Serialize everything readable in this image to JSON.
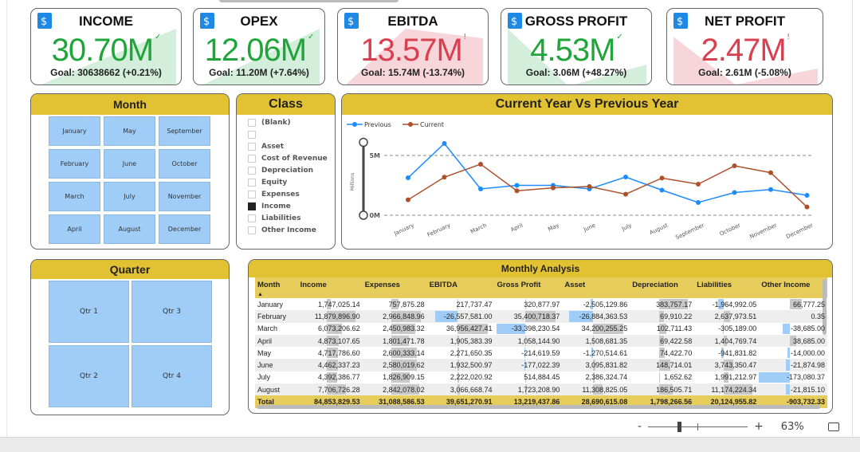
{
  "kpis": [
    {
      "title": "INCOME",
      "value": "30.70M",
      "goal": "Goal: 30638662 (+0.21%)",
      "status": "good",
      "icon": "invoice-dollar-icon"
    },
    {
      "title": "OPEX",
      "value": "12.06M",
      "goal": "Goal: 11.20M (+7.64%)",
      "status": "good",
      "icon": "card-payment-icon"
    },
    {
      "title": "EBITDA",
      "value": "13.57M",
      "goal": "Goal: 15.74M (-13.74%)",
      "status": "bad",
      "icon": "dollar-down-arrow-icon"
    },
    {
      "title": "GROSS PROFIT",
      "value": "4.53M",
      "goal": "Goal: 3.06M (+48.27%)",
      "status": "good",
      "icon": "money-bag-icon"
    },
    {
      "title": "NET PROFIT",
      "value": "2.47M",
      "goal": "Goal: 2.61M (-5.08%)",
      "status": "bad",
      "icon": "money-bag-icon"
    }
  ],
  "colors": {
    "good": "#1FA53A",
    "bad": "#D9404F",
    "good_bg": "#D3EEDA",
    "bad_bg": "#F6D6DA",
    "header": "#E2C132",
    "slicer": "#A0CDF7",
    "previous": "#1A8CFF",
    "current": "#B0502A"
  },
  "month_slicer": {
    "title": "Month",
    "items": [
      "January",
      "May",
      "September",
      "February",
      "June",
      "October",
      "March",
      "July",
      "November",
      "April",
      "August",
      "December"
    ]
  },
  "class_slicer": {
    "title": "Class",
    "items": [
      {
        "label": "(Blank)",
        "checked": false
      },
      {
        "label": "",
        "checked": false
      },
      {
        "label": "Asset",
        "checked": false
      },
      {
        "label": "Cost of Revenue",
        "checked": false
      },
      {
        "label": "Depreciation",
        "checked": false
      },
      {
        "label": "Equity",
        "checked": false
      },
      {
        "label": "Expenses",
        "checked": false
      },
      {
        "label": "Income",
        "checked": true
      },
      {
        "label": "Liabilities",
        "checked": false
      },
      {
        "label": "Other Income",
        "checked": false
      }
    ]
  },
  "quarter_slicer": {
    "title": "Quarter",
    "items": [
      "Qtr 1",
      "Qtr 3",
      "Qtr 2",
      "Qtr 4"
    ]
  },
  "chart_data": {
    "type": "line",
    "title": "Current Year Vs Previous Year",
    "ylabel": "Millions",
    "xlabel": "",
    "categories": [
      "January",
      "February",
      "March",
      "April",
      "May",
      "June",
      "July",
      "August",
      "September",
      "October",
      "November",
      "December"
    ],
    "series": [
      {
        "name": "Previous",
        "values": [
          3.13,
          6.0,
          2.2,
          2.5,
          2.5,
          2.2,
          3.2,
          2.1,
          1.07,
          1.9,
          2.15,
          1.67
        ]
      },
      {
        "name": "Current",
        "values": [
          1.29,
          3.18,
          4.27,
          2.04,
          2.29,
          2.4,
          1.76,
          3.11,
          2.6,
          4.13,
          3.56,
          0.69
        ]
      }
    ],
    "yticks": [
      "0M",
      "5M"
    ],
    "ylim": [
      0,
      6.5
    ],
    "grid": true,
    "legend": "top-left"
  },
  "table": {
    "title": "Monthly Analysis",
    "columns": [
      "Month",
      "Income",
      "Expenses",
      "EBITDA",
      "Gross Profit",
      "Asset",
      "Depreciation",
      "Liabilities",
      "Other Income"
    ],
    "rows": [
      [
        "January",
        "1,747,025.14",
        "757,875.28",
        "217,737.47",
        "320,877.97",
        "-2,505,129.86",
        "383,757.17",
        "-1,964,992.05",
        "66,777.25"
      ],
      [
        "February",
        "11,879,896.90",
        "2,966,848.96",
        "-26,557,581.00",
        "35,400,718.37",
        "-26,884,363.53",
        "69,910.22",
        "2,637,973.51",
        "0.35"
      ],
      [
        "March",
        "6,073,206.62",
        "2,450,983.32",
        "36,956,427.41",
        "-33,398,230.54",
        "34,200,255.25",
        "102,711.43",
        "-305,189.00",
        "-38,685.00"
      ],
      [
        "April",
        "4,873,107.65",
        "1,801,471.78",
        "1,905,383.39",
        "1,058,144.90",
        "1,508,681.35",
        "69,422.58",
        "1,404,769.74",
        "38,685.00"
      ],
      [
        "May",
        "4,717,786.60",
        "2,600,333.14",
        "2,271,650.35",
        "-214,619.59",
        "-1,270,514.61",
        "74,422.70",
        "-941,831.82",
        "-14,000.00"
      ],
      [
        "June",
        "4,462,337.23",
        "2,580,019.62",
        "1,932,500.97",
        "-177,022.39",
        "3,095,831.82",
        "148,714.01",
        "3,743,350.47",
        "-21,874.98"
      ],
      [
        "July",
        "4,392,386.77",
        "1,826,909.15",
        "2,222,020.92",
        "514,884.45",
        "2,386,324.74",
        "1,652.62",
        "1,991,212.97",
        "-173,080.37"
      ],
      [
        "August",
        "7,706,726.28",
        "2,842,078.02",
        "3,066,668.74",
        "1,723,208.90",
        "11,308,825.05",
        "186,505.71",
        "11,174,224.34",
        "-21,815.10"
      ]
    ],
    "total": [
      "Total",
      "84,853,829.53",
      "31,088,586.53",
      "39,651,270.91",
      "13,219,437.86",
      "28,690,615.08",
      "1,798,266.56",
      "20,124,955.82",
      "-903,732.33"
    ]
  },
  "zoom": {
    "minus": "-",
    "plus": "+",
    "level": "63%",
    "level_value": 63
  }
}
